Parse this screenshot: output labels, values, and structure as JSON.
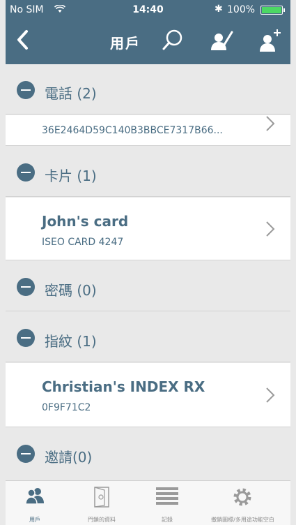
{
  "status_bar": {
    "carrier": "No SIM",
    "time": "14:40",
    "bluetooth": "✱",
    "battery": "100%"
  },
  "nav": {
    "title": "用戶"
  },
  "sections": {
    "phones": {
      "title": "電話 (2)",
      "item": {
        "subtitle": "36E2464D59C140B3BBCE7317B66..."
      }
    },
    "cards": {
      "title": "卡片 (1)",
      "item": {
        "title": "John's card",
        "subtitle": "ISEO CARD 4247"
      }
    },
    "passwords": {
      "title": "密碼 (0)"
    },
    "fingerprints": {
      "title": "指紋 (1)",
      "item": {
        "title": "Christian's INDEX RX",
        "subtitle": "0F9F71C2"
      }
    },
    "invites": {
      "title": "邀請(0)"
    }
  },
  "tabbar": {
    "users": "用戶",
    "door_info": "門鎖的資料",
    "logs": "記錄",
    "settings": "撤銷圖標/多用途功能空白"
  },
  "colors": {
    "primary": "#4a6d83",
    "background": "#e9e9e9",
    "battery_fill": "#4cd964"
  },
  "icons": [
    "back-chevron-icon",
    "search-icon",
    "edit-user-icon",
    "add-user-icon",
    "users-icon",
    "door-icon",
    "list-icon",
    "gear-icon"
  ]
}
